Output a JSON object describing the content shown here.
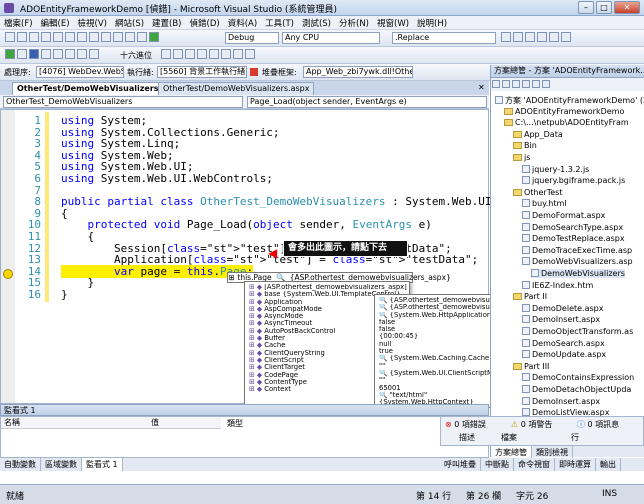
{
  "window": {
    "title": "ADOEntityFrameworkDemo [偵錯] - Microsoft Visual Studio (系統管理員)"
  },
  "menu": [
    "檔案(F)",
    "編輯(E)",
    "檢視(V)",
    "網站(S)",
    "建置(B)",
    "偵錯(D)",
    "資料(A)",
    "工具(T)",
    "測試(S)",
    "分析(N)",
    "視窗(W)",
    "說明(H)"
  ],
  "toolbar": {
    "config": "Debug",
    "platform": "Any CPU",
    "find": ".Replace",
    "hex": "十六進位"
  },
  "debugbar": {
    "process_label": "處理序:",
    "process": "[4076] WebDev.WebServer",
    "thread_label": "執行緒:",
    "thread": "[5560] 背景工作執行緒",
    "frame_label": "堆疊框架:",
    "frame": "App_Web_zbi7ywk.dll!Other"
  },
  "tabs": [
    "OtherTest/DemoWebVisualizers.aspx.cs",
    "OtherTest/DemoWebVisualizers.aspx"
  ],
  "nav": {
    "class": "OtherTest_DemoWebVisualizers",
    "method": "Page_Load(object sender, EventArgs e)"
  },
  "code_lines": [
    {
      "n": "1",
      "t": "using System;"
    },
    {
      "n": "2",
      "t": "using System.Collections.Generic;"
    },
    {
      "n": "3",
      "t": "using System.Linq;"
    },
    {
      "n": "4",
      "t": "using System.Web;"
    },
    {
      "n": "5",
      "t": "using System.Web.UI;"
    },
    {
      "n": "6",
      "t": "using System.Web.UI.WebControls;"
    },
    {
      "n": "7",
      "t": ""
    },
    {
      "n": "8",
      "t": "public partial class OtherTest_DemoWebVisualizers : System.Web.UI.Page"
    },
    {
      "n": "9",
      "t": "{"
    },
    {
      "n": "10",
      "t": "    protected void Page_Load(object sender, EventArgs e)"
    },
    {
      "n": "11",
      "t": "    {"
    },
    {
      "n": "12",
      "t": "        Session[\"test\"] = \"testData\";"
    },
    {
      "n": "13",
      "t": "        Application[\"test\"] = \"testData\";"
    },
    {
      "n": "14",
      "t": "        var page = this.Page;"
    },
    {
      "n": "15",
      "t": "    }"
    },
    {
      "n": "16",
      "t": "}"
    }
  ],
  "tooltip": "會多出此圖示，請點下去",
  "datatip": {
    "expr": "this.Page",
    "value": "{ASP.othertest_demowebvisualizers_aspx}"
  },
  "members": [
    "[ASP.othertest_demowebvisualizers_aspx]",
    "base {System.Web.UI.TemplateControl}",
    "Application",
    "AspCompatMode",
    "AsyncMode",
    "AsyncTimeout",
    "AutoPostBackControl",
    "Buffer",
    "Cache",
    "ClientQueryString",
    "ClientScript",
    "ClientTarget",
    "CodePage",
    "ContentType",
    "Context"
  ],
  "member_values": [
    "{ASP.othertest_demowebvisualizers_aspx}",
    "{ASP.othertest_demowebvisualizers_aspx}",
    "{System.Web.HttpApplicationState}",
    "false",
    "false",
    "{00:00:45}",
    "null",
    "true",
    "{System.Web.Caching.Cache}",
    "\"\"",
    "{System.Web.UI.ClientScriptManager}",
    "\"\"",
    "65001",
    "\"text/html\"",
    "{System.Web.HttpContext}"
  ],
  "solution": {
    "title": "方案總管 - 方案 'ADOEntityFramework...",
    "items": [
      {
        "d": 0,
        "k": "fi",
        "t": "方案 'ADOEntityFrameworkDemo' (2"
      },
      {
        "d": 1,
        "k": "fo",
        "t": "ADOEntityFrameworkDemo"
      },
      {
        "d": 1,
        "k": "fo",
        "t": "C:\\...\\netpub\\ADOEntityFram"
      },
      {
        "d": 2,
        "k": "fo",
        "t": "App_Data"
      },
      {
        "d": 2,
        "k": "fo",
        "t": "Bin"
      },
      {
        "d": 2,
        "k": "fo",
        "t": "js"
      },
      {
        "d": 3,
        "k": "fi",
        "t": "jquery-1.3.2.js"
      },
      {
        "d": 3,
        "k": "fi",
        "t": "jquery.bgiframe.pack.js"
      },
      {
        "d": 2,
        "k": "fo",
        "t": "OtherTest"
      },
      {
        "d": 3,
        "k": "fi",
        "t": "buy.html"
      },
      {
        "d": 3,
        "k": "fi",
        "t": "DemoFormat.aspx"
      },
      {
        "d": 3,
        "k": "fi",
        "t": "DemoSearchType.aspx"
      },
      {
        "d": 3,
        "k": "fi",
        "t": "DemoTestReplace.aspx"
      },
      {
        "d": 3,
        "k": "fi",
        "t": "DemoTraceExecTime.asp"
      },
      {
        "d": 3,
        "k": "fi",
        "t": "DemoWebVisualizers.asp"
      },
      {
        "d": 4,
        "k": "fi",
        "t": "DemoWebVisualizers"
      },
      {
        "d": 3,
        "k": "fi",
        "t": "IE6Z-Index.htm"
      },
      {
        "d": 2,
        "k": "fo",
        "t": "Part II"
      },
      {
        "d": 3,
        "k": "fi",
        "t": "DemoDelete.aspx"
      },
      {
        "d": 3,
        "k": "fi",
        "t": "DemoInsert.aspx"
      },
      {
        "d": 3,
        "k": "fi",
        "t": "DemoObjectTransform.as"
      },
      {
        "d": 3,
        "k": "fi",
        "t": "DemoSearch.aspx"
      },
      {
        "d": 3,
        "k": "fi",
        "t": "DemoUpdate.aspx"
      },
      {
        "d": 2,
        "k": "fo",
        "t": "Part III"
      },
      {
        "d": 3,
        "k": "fi",
        "t": "DemoContainsExpression"
      },
      {
        "d": 3,
        "k": "fi",
        "t": "DemoDetachObjectUpda"
      },
      {
        "d": 3,
        "k": "fi",
        "t": "DemoInsert.aspx"
      },
      {
        "d": 3,
        "k": "fi",
        "t": "DemoListView.aspx"
      },
      {
        "d": 3,
        "k": "fi",
        "t": "DemoLongTimeTest.aspx"
      }
    ]
  },
  "watch": {
    "title": "監看式 1",
    "col_name": "名稱",
    "col_value": "值",
    "col_type": "類型"
  },
  "errors": {
    "errors": "0 項錯誤",
    "warnings": "0 項警告",
    "messages": "0 項訊息",
    "col_desc": "描述",
    "col_file": "檔案",
    "col_line": "行"
  },
  "bottom_tabs": [
    "自動變數",
    "區域變數",
    "監看式 1"
  ],
  "right_tabs": [
    "呼叫堆疊",
    "中斷點",
    "命令視窗",
    "即時運算",
    "輸出"
  ],
  "side_tabs": [
    "方案總管",
    "類別檢視"
  ],
  "status": {
    "ready": "就緒",
    "line": "第 14 行",
    "col": "第 26 欄",
    "char": "字元 26",
    "ins": "INS"
  }
}
